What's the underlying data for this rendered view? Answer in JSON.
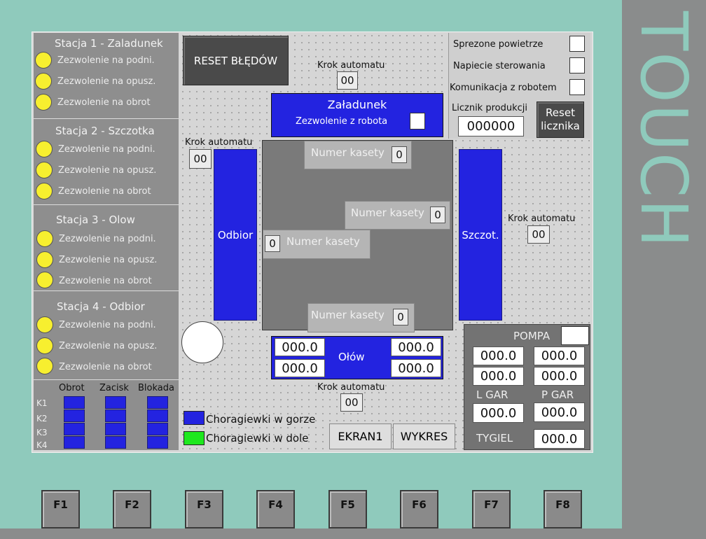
{
  "brand": "TOUCH",
  "stations": [
    {
      "title": "Stacja 1 - Zaladunek",
      "items": [
        "Zezwolenie na podni.",
        "Zezwolenie na opusz.",
        "Zezwolenie na obrot"
      ]
    },
    {
      "title": "Stacja 2 - Szczotka",
      "items": [
        "Zezwolenie na podni.",
        "Zezwolenie na opusz.",
        "Zezwolenie na obrot"
      ]
    },
    {
      "title": "Stacja 3 - Olow",
      "items": [
        "Zezwolenie na podni.",
        "Zezwolenie na opusz.",
        "Zezwolenie na obrot"
      ]
    },
    {
      "title": "Stacja 4 - Odbior",
      "items": [
        "Zezwolenie na podni.",
        "Zezwolenie na opusz.",
        "Zezwolenie na obrot"
      ]
    }
  ],
  "clamps": {
    "columns": [
      "Obrot",
      "Zacisk",
      "Blokada"
    ],
    "rows": [
      "K1",
      "K2",
      "K3",
      "K4"
    ]
  },
  "reset_errors": "RESET BŁĘDÓW",
  "krok_label": "Krok automatu",
  "krok_top": "00",
  "krok_left": "00",
  "krok_right": "00",
  "krok_bottom": "00",
  "zaladunek": {
    "title": "Załadunek",
    "subtitle": "Zezwolenie z robota"
  },
  "odbior": "Odbior",
  "szczot": "Szczot.",
  "kaseta_label": "Numer kasety",
  "kaseta_values": {
    "top": "0",
    "right": "0",
    "left": "0",
    "bottom": "0"
  },
  "olow": {
    "label": "Ołów",
    "values": [
      "000.0",
      "000.0",
      "000.0",
      "000.0"
    ]
  },
  "status": {
    "items": [
      "Sprezone powietrze",
      "Napiecie sterowania",
      "Komunikacja z robotem"
    ]
  },
  "licznik": {
    "label": "Licznik produkcji",
    "value": "000000",
    "reset_label": "Reset licznika"
  },
  "pompa": {
    "label": "POMPA",
    "values": [
      "000.0",
      "000.0",
      "000.0",
      "000.0"
    ],
    "lgar_label": "L GAR",
    "pgar_label": "P GAR",
    "lgar": "000.0",
    "pgar": "000.0",
    "tygiel_label": "TYGIEL",
    "tygiel": "000.0"
  },
  "legend": {
    "up": "Choragiewki w gorze",
    "down": "Choragiewki w dole",
    "up_color": "#2323e0",
    "down_color": "#1ee81e"
  },
  "nav": {
    "ekran1": "EKRAN1",
    "wykres": "WYKRES"
  },
  "fkeys": [
    "F1",
    "F2",
    "F3",
    "F4",
    "F5",
    "F6",
    "F7",
    "F8"
  ]
}
